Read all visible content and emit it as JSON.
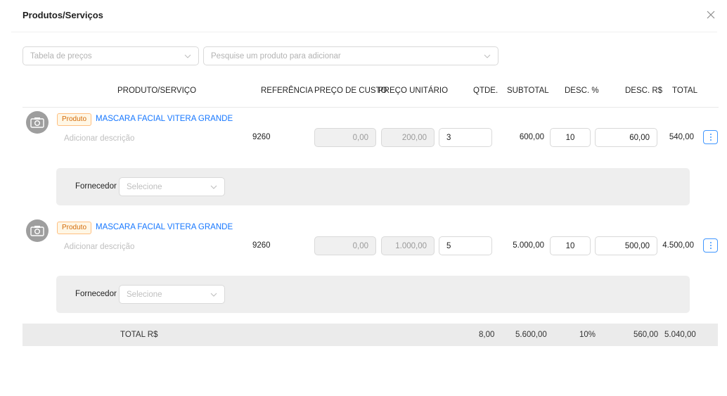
{
  "title": "Produtos/Serviços",
  "filters": {
    "price_table_placeholder": "Tabela de preços",
    "search_placeholder": "Pesquise um produto para adicionar"
  },
  "columns": {
    "product": "PRODUTO/SERVIÇO",
    "reference": "REFERÊNCIA",
    "cost_price": "PREÇO DE CUSTO",
    "unit_price": "PREÇO UNITÁRIO",
    "qty": "QTDE.",
    "subtotal": "SUBTOTAL",
    "discount_pct": "DESC. %",
    "discount_value": "DESC. R$",
    "total": "TOTAL"
  },
  "items": [
    {
      "tag": "Produto",
      "name": "MASCARA FACIAL VITERA GRANDE",
      "description_placeholder": "Adicionar descrição",
      "reference": "9260",
      "cost_price": "0,00",
      "unit_price": "200,00",
      "qty": "3",
      "subtotal": "600,00",
      "discount_pct": "10",
      "discount_value": "60,00",
      "total": "540,00",
      "supplier_label": "Fornecedor",
      "supplier_placeholder": "Selecione"
    },
    {
      "tag": "Produto",
      "name": "MASCARA FACIAL VITERA GRANDE",
      "description_placeholder": "Adicionar descrição",
      "reference": "9260",
      "cost_price": "0,00",
      "unit_price": "1.000,00",
      "qty": "5",
      "subtotal": "5.000,00",
      "discount_pct": "10",
      "discount_value": "500,00",
      "total": "4.500,00",
      "supplier_label": "Fornecedor",
      "supplier_placeholder": "Selecione"
    }
  ],
  "totals": {
    "label": "TOTAL R$",
    "qty": "8,00",
    "subtotal": "5.600,00",
    "discount_pct": "10%",
    "discount_value": "560,00",
    "total": "5.040,00"
  },
  "icons": {
    "close": "close-icon",
    "chevron": "chevron-down-icon",
    "camera": "camera-icon",
    "more": "more-vertical-icon"
  }
}
